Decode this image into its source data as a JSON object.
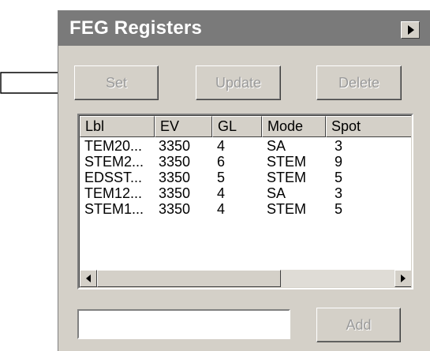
{
  "panel": {
    "title": "FEG Registers",
    "collapse_icon": "triangle-right-icon"
  },
  "pointer": {
    "icon": "hollow-arrow-right-icon"
  },
  "toolbar": {
    "set_label": "Set",
    "update_label": "Update",
    "delete_label": "Delete"
  },
  "list": {
    "columns": [
      "Lbl",
      "EV",
      "GL",
      "Mode",
      "Spot"
    ],
    "rows": [
      [
        "TEM20...",
        "3350",
        "4",
        "SA",
        "3"
      ],
      [
        "STEM2...",
        "3350",
        "6",
        "STEM",
        "9"
      ],
      [
        "EDSST...",
        "3350",
        "5",
        "STEM",
        "5"
      ],
      [
        "TEM12...",
        "3350",
        "4",
        "SA",
        "3"
      ],
      [
        "STEM1...",
        "3350",
        "4",
        "STEM",
        "5"
      ]
    ]
  },
  "add": {
    "input_value": "",
    "add_label": "Add"
  }
}
